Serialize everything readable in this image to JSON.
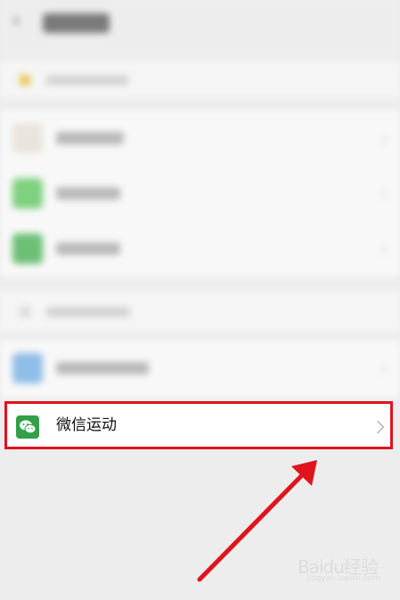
{
  "header": {
    "back_icon": "chevron-left-icon"
  },
  "blurred_rows": 5,
  "highlighted_row": {
    "label": "微信运动",
    "icon": "wechat-icon",
    "chevron": "chevron-right-icon"
  },
  "watermark": {
    "text": "Baidu经验",
    "sub": "jingyan.baidu.com"
  },
  "colors": {
    "highlight": "#e0141d",
    "wechat_green": "#31a048",
    "background": "#ededed"
  }
}
